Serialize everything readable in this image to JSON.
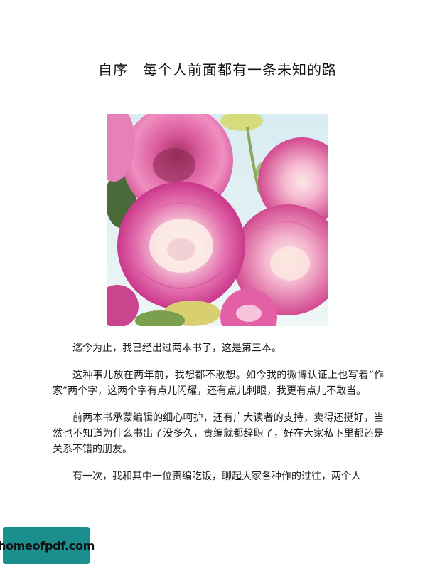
{
  "document": {
    "title": "自序　每个人前面都有一条未知的路",
    "figure": {
      "subject": "pink-roses-photo"
    },
    "paragraphs": [
      "迄今为止，我已经出过两本书了，这是第三本。",
      "这种事儿放在两年前，我想都不敢想。如今我的微博认证上也写着“作家”两个字，这两个字有点儿闪耀，还有点儿刺眼，我更有点儿不敢当。",
      "前两本书承蒙编辑的细心呵护，还有广大读者的支持，卖得还挺好，当然也不知道为什么书出了没多久，责编就都辞职了，好在大家私下里都还是关系不错的朋友。",
      "有一次，我和其中一位责编吃饭，聊起大家各种作的过往，两个人"
    ]
  },
  "watermark": {
    "text": "homeofpdf.com",
    "color": "#1a8f8e"
  }
}
